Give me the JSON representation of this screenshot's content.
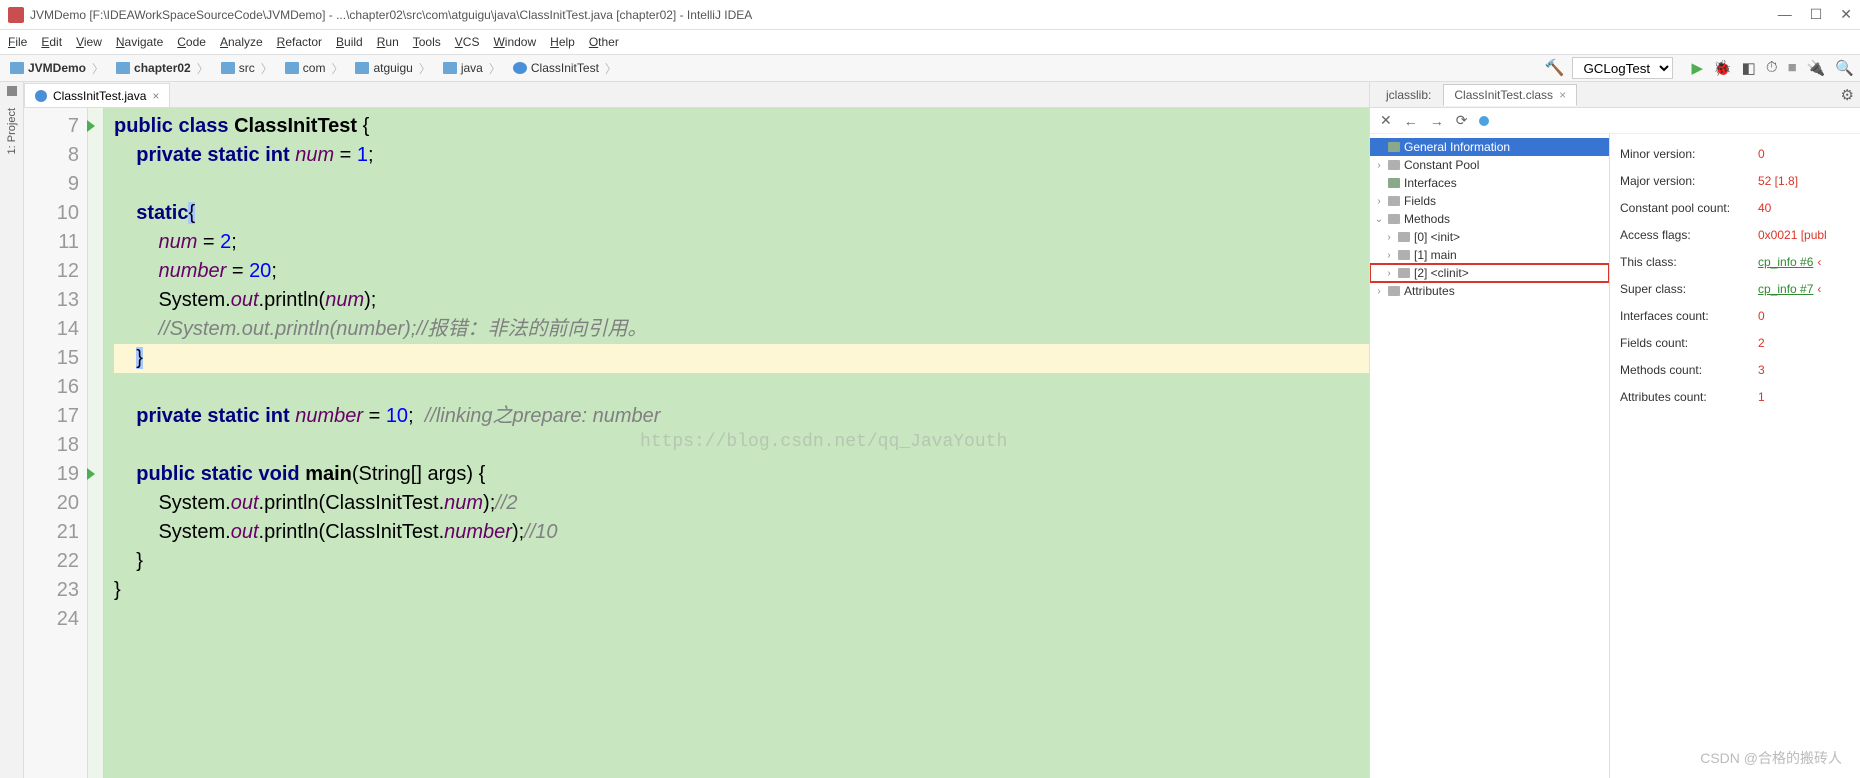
{
  "window": {
    "title": "JVMDemo [F:\\IDEAWorkSpaceSourceCode\\JVMDemo] - ...\\chapter02\\src\\com\\atguigu\\java\\ClassInitTest.java [chapter02] - IntelliJ IDEA"
  },
  "menus": [
    "File",
    "Edit",
    "View",
    "Navigate",
    "Code",
    "Analyze",
    "Refactor",
    "Build",
    "Run",
    "Tools",
    "VCS",
    "Window",
    "Help",
    "Other"
  ],
  "breadcrumbs": [
    {
      "icon": "folder",
      "label": "JVMDemo",
      "bold": true
    },
    {
      "icon": "folder",
      "label": "chapter02",
      "bold": true
    },
    {
      "icon": "folder",
      "label": "src"
    },
    {
      "icon": "folder",
      "label": "com"
    },
    {
      "icon": "folder",
      "label": "atguigu"
    },
    {
      "icon": "folder",
      "label": "java"
    },
    {
      "icon": "class",
      "label": "ClassInitTest"
    }
  ],
  "run_config": "GCLogTest",
  "sidebar_left": {
    "project": "1: Project"
  },
  "editor_tab": "ClassInitTest.java",
  "code_lines": [
    {
      "n": 7,
      "run": true,
      "html": "<span class='kw'>public</span> <span class='kw'>class</span> <span class='str'><b>ClassInitTest</b></span> {"
    },
    {
      "n": 8,
      "html": "    <span class='kw'>private</span> <span class='kw'>static</span> <span class='ty'>int</span> <span class='fld'>num</span> = <span class='num'>1</span>;"
    },
    {
      "n": 9,
      "html": ""
    },
    {
      "n": 10,
      "html": "    <span class='kw'>static</span><span class='carsel'>{</span>"
    },
    {
      "n": 11,
      "html": "        <span class='fld'>num</span> = <span class='num'>2</span>;"
    },
    {
      "n": 12,
      "html": "        <span class='fld'>number</span> = <span class='num'>20</span>;"
    },
    {
      "n": 13,
      "html": "        System.<span class='fld'>out</span>.println(<span class='fld'>num</span>);"
    },
    {
      "n": 14,
      "html": "        <span class='cm'>//System.out.println(number);//报错：非法的前向引用。</span>"
    },
    {
      "n": 15,
      "hl": true,
      "html": "    <span class='carsel'>}</span>"
    },
    {
      "n": 16,
      "html": ""
    },
    {
      "n": 17,
      "html": "    <span class='kw'>private</span> <span class='kw'>static</span> <span class='ty'>int</span> <span class='fld'>number</span> = <span class='num'>10</span>;  <span class='cm'>//linking之prepare: number </span>"
    },
    {
      "n": 18,
      "html": ""
    },
    {
      "n": 19,
      "run": true,
      "html": "    <span class='kw'>public</span> <span class='kw'>static</span> <span class='ty'>void</span> <b>main</b>(String[] args) {"
    },
    {
      "n": 20,
      "html": "        System.<span class='fld'>out</span>.println(ClassInitTest.<span class='fld'>num</span>);<span class='cm'>//2</span>"
    },
    {
      "n": 21,
      "html": "        System.<span class='fld'>out</span>.println(ClassInitTest.<span class='fld'>number</span>);<span class='cm'>//10</span>"
    },
    {
      "n": 22,
      "html": "    }"
    },
    {
      "n": 23,
      "html": "}"
    },
    {
      "n": 24,
      "html": ""
    }
  ],
  "right_tabs": {
    "a": "jclasslib:",
    "b": "ClassInitTest.class"
  },
  "tree": [
    {
      "lvl": 0,
      "arrow": "",
      "label": "General Information",
      "sel": true,
      "ic": "gr"
    },
    {
      "lvl": 0,
      "arrow": ">",
      "label": "Constant Pool"
    },
    {
      "lvl": 0,
      "arrow": "",
      "label": "Interfaces",
      "ic": "gr"
    },
    {
      "lvl": 0,
      "arrow": ">",
      "label": "Fields"
    },
    {
      "lvl": 0,
      "arrow": "v",
      "label": "Methods"
    },
    {
      "lvl": 1,
      "arrow": ">",
      "label": "[0] <init>"
    },
    {
      "lvl": 1,
      "arrow": ">",
      "label": "[1] main"
    },
    {
      "lvl": 1,
      "arrow": ">",
      "label": "[2] <clinit>",
      "boxed": true
    },
    {
      "lvl": 0,
      "arrow": ">",
      "label": "Attributes"
    }
  ],
  "props": [
    {
      "k": "Minor version:",
      "v": "0",
      "cls": ""
    },
    {
      "k": "Major version:",
      "v": "52 [1.8]",
      "cls": ""
    },
    {
      "k": "Constant pool count:",
      "v": "40",
      "cls": ""
    },
    {
      "k": "Access flags:",
      "v": "0x0021 [publ",
      "cls": ""
    },
    {
      "k": "This class:",
      "v": "cp_info #6",
      "cls": "lnk",
      "arr": true
    },
    {
      "k": "Super class:",
      "v": "cp_info #7",
      "cls": "lnk",
      "arr": true
    },
    {
      "k": "Interfaces count:",
      "v": "0",
      "cls": ""
    },
    {
      "k": "Fields count:",
      "v": "2",
      "cls": ""
    },
    {
      "k": "Methods count:",
      "v": "3",
      "cls": ""
    },
    {
      "k": "Attributes count:",
      "v": "1",
      "cls": ""
    }
  ],
  "watermark": "CSDN @合格的搬砖人",
  "watermark2": "https://blog.csdn.net/qq_JavaYouth"
}
